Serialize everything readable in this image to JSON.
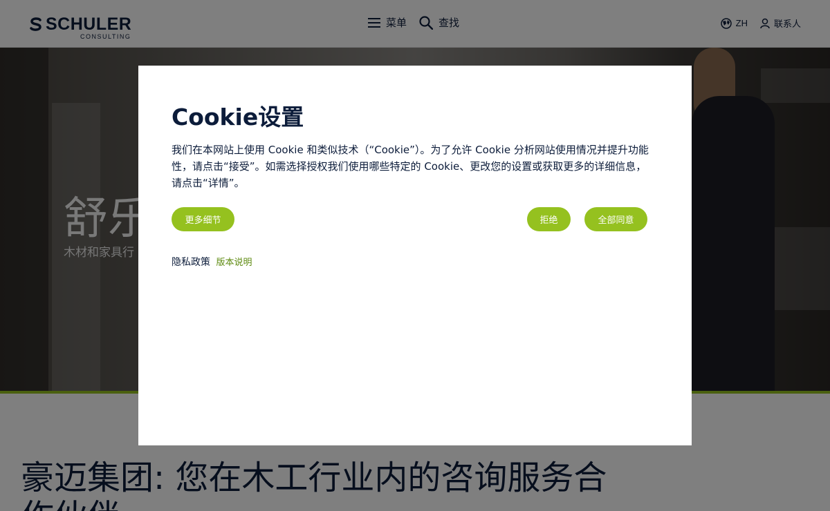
{
  "header": {
    "logo_text": "SCHULER",
    "logo_sub": "CONSULTING",
    "menu_label": "菜单",
    "search_label": "查找",
    "lang_label": "ZH",
    "contact_label": "联系人"
  },
  "hero": {
    "title": "舒乐",
    "subtitle": "木材和家具行"
  },
  "below": {
    "title": "豪迈集团: 您在木工行业内的咨询服务合作伙伴"
  },
  "cookie_modal": {
    "title": "Cookie设置",
    "body": "我们在本网站上使用 Cookie 和类似技术（“Cookie”）。为了允许 Cookie 分析网站使用情况并提升功能性，请点击“接受”。如需选择授权我们使用哪些特定的 Cookie、更改您的设置或获取更多的详细信息，请点击“详情”。",
    "more_details_label": "更多细节",
    "reject_label": "拒绝",
    "accept_all_label": "全部同意",
    "privacy_label": "隐私政策",
    "imprint_label": "版本说明"
  },
  "colors": {
    "accent": "#95c11f",
    "navy": "#0c1c3a"
  }
}
